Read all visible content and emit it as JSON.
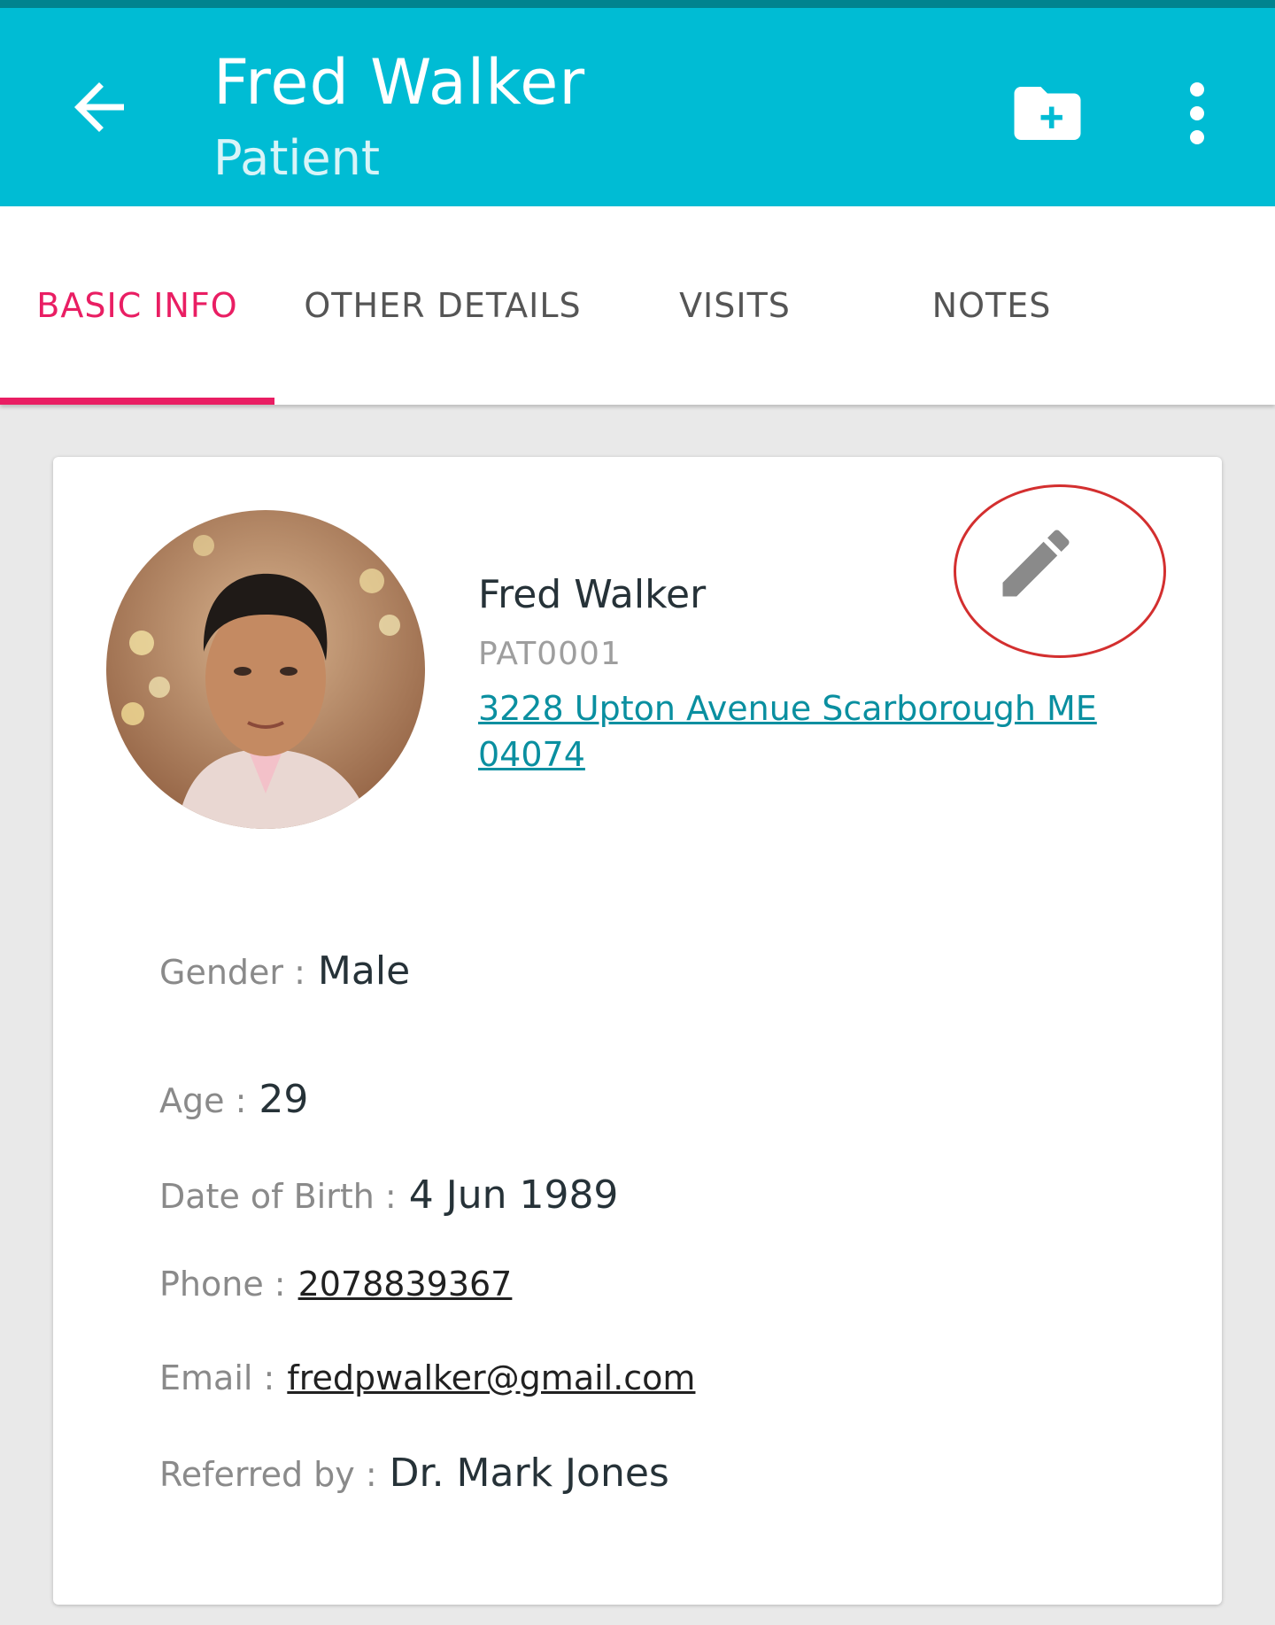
{
  "header": {
    "title": "Fred Walker",
    "subtitle": "Patient",
    "back_icon": "arrow-back-icon",
    "add_folder_icon": "create-new-folder-icon",
    "more_icon": "more-vert-icon"
  },
  "tabs": [
    {
      "label": "BASIC INFO",
      "active": true
    },
    {
      "label": "OTHER DETAILS",
      "active": false
    },
    {
      "label": "VISITS",
      "active": false
    },
    {
      "label": "NOTES",
      "active": false
    }
  ],
  "patient": {
    "name": "Fred Walker",
    "id": "PAT0001",
    "address": "3228 Upton Avenue Scarborough ME 04074",
    "edit_icon": "pencil-icon"
  },
  "details": {
    "gender": {
      "label": "Gender :",
      "value": "Male"
    },
    "age": {
      "label": "Age :",
      "value": "29"
    },
    "dob": {
      "label": "Date of Birth :",
      "value": "4 Jun 1989"
    },
    "phone": {
      "label": "Phone :",
      "value": "2078839367"
    },
    "email": {
      "label": "Email :",
      "value": "fredpwalker@gmail.com"
    },
    "referred": {
      "label": "Referred by :",
      "value": "Dr. Mark Jones"
    }
  },
  "colors": {
    "appbar": "#00bcd4",
    "accent": "#e91e63",
    "link": "#0a8fa0",
    "highlight": "#d32f2f"
  }
}
